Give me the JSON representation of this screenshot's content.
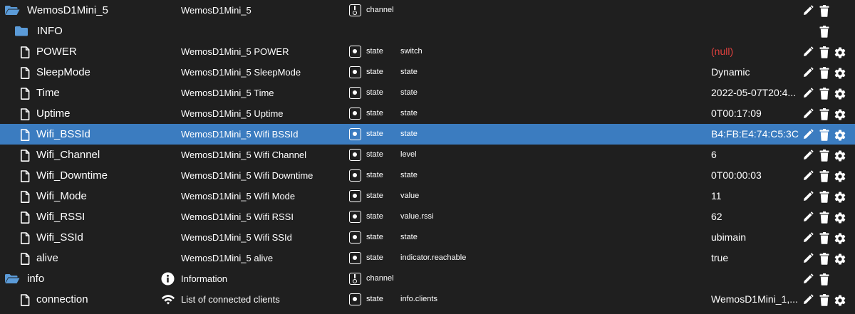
{
  "colors": {
    "background": "#1f1f1f",
    "selected_row": "#3b7cc0",
    "folder": "#5b9bd8",
    "null_value": "#e0413e",
    "text": "#ffffff"
  },
  "rows": [
    {
      "id": "WemosD1Mini_5",
      "level": 0,
      "tree_icon": "folder-open-icon",
      "name": "WemosD1Mini_5",
      "name_icon": "",
      "type_icon": "channel-icon",
      "type": "channel",
      "role": "",
      "value": "",
      "value_state": "",
      "actions": [
        "edit-icon",
        "delete-icon"
      ],
      "selected": false
    },
    {
      "id": "INFO",
      "level": 1,
      "tree_icon": "folder-icon",
      "name": "",
      "name_icon": "",
      "type_icon": "",
      "type": "",
      "role": "",
      "value": "",
      "value_state": "",
      "actions": [
        "delete-icon"
      ],
      "selected": false
    },
    {
      "id": "POWER",
      "level": 1,
      "tree_icon": "file-icon",
      "name": "WemosD1Mini_5 POWER",
      "name_icon": "",
      "type_icon": "state-icon",
      "type": "state",
      "role": "switch",
      "value": "(null)",
      "value_state": "null",
      "actions": [
        "edit-icon",
        "delete-icon",
        "settings-icon"
      ],
      "selected": false
    },
    {
      "id": "SleepMode",
      "level": 1,
      "tree_icon": "file-icon",
      "name": "WemosD1Mini_5 SleepMode",
      "name_icon": "",
      "type_icon": "state-icon",
      "type": "state",
      "role": "state",
      "value": "Dynamic",
      "value_state": "",
      "actions": [
        "edit-icon",
        "delete-icon",
        "settings-icon"
      ],
      "selected": false
    },
    {
      "id": "Time",
      "level": 1,
      "tree_icon": "file-icon",
      "name": "WemosD1Mini_5 Time",
      "name_icon": "",
      "type_icon": "state-icon",
      "type": "state",
      "role": "state",
      "value": "2022-05-07T20:4...",
      "value_state": "",
      "actions": [
        "edit-icon",
        "delete-icon",
        "settings-icon"
      ],
      "selected": false
    },
    {
      "id": "Uptime",
      "level": 1,
      "tree_icon": "file-icon",
      "name": "WemosD1Mini_5 Uptime",
      "name_icon": "",
      "type_icon": "state-icon",
      "type": "state",
      "role": "state",
      "value": "0T00:17:09",
      "value_state": "",
      "actions": [
        "edit-icon",
        "delete-icon",
        "settings-icon"
      ],
      "selected": false
    },
    {
      "id": "Wifi_BSSId",
      "level": 1,
      "tree_icon": "file-icon",
      "name": "WemosD1Mini_5 Wifi BSSId",
      "name_icon": "",
      "type_icon": "state-icon",
      "type": "state",
      "role": "state",
      "value": "B4:FB:E4:74:C5:3C",
      "value_state": "",
      "actions": [
        "edit-icon",
        "delete-icon",
        "settings-icon"
      ],
      "selected": true
    },
    {
      "id": "Wifi_Channel",
      "level": 1,
      "tree_icon": "file-icon",
      "name": "WemosD1Mini_5 Wifi Channel",
      "name_icon": "",
      "type_icon": "state-icon",
      "type": "state",
      "role": "level",
      "value": "6",
      "value_state": "",
      "actions": [
        "edit-icon",
        "delete-icon",
        "settings-icon"
      ],
      "selected": false
    },
    {
      "id": "Wifi_Downtime",
      "level": 1,
      "tree_icon": "file-icon",
      "name": "WemosD1Mini_5 Wifi Downtime",
      "name_icon": "",
      "type_icon": "state-icon",
      "type": "state",
      "role": "state",
      "value": "0T00:00:03",
      "value_state": "",
      "actions": [
        "edit-icon",
        "delete-icon",
        "settings-icon"
      ],
      "selected": false
    },
    {
      "id": "Wifi_Mode",
      "level": 1,
      "tree_icon": "file-icon",
      "name": "WemosD1Mini_5 Wifi Mode",
      "name_icon": "",
      "type_icon": "state-icon",
      "type": "state",
      "role": "value",
      "value": "11",
      "value_state": "",
      "actions": [
        "edit-icon",
        "delete-icon",
        "settings-icon"
      ],
      "selected": false
    },
    {
      "id": "Wifi_RSSI",
      "level": 1,
      "tree_icon": "file-icon",
      "name": "WemosD1Mini_5 Wifi RSSI",
      "name_icon": "",
      "type_icon": "state-icon",
      "type": "state",
      "role": "value.rssi",
      "value": "62",
      "value_state": "",
      "actions": [
        "edit-icon",
        "delete-icon",
        "settings-icon"
      ],
      "selected": false
    },
    {
      "id": "Wifi_SSId",
      "level": 1,
      "tree_icon": "file-icon",
      "name": "WemosD1Mini_5 Wifi SSId",
      "name_icon": "",
      "type_icon": "state-icon",
      "type": "state",
      "role": "state",
      "value": "ubimain",
      "value_state": "",
      "actions": [
        "edit-icon",
        "delete-icon",
        "settings-icon"
      ],
      "selected": false
    },
    {
      "id": "alive",
      "level": 1,
      "tree_icon": "file-icon",
      "name": "WemosD1Mini_5 alive",
      "name_icon": "",
      "type_icon": "state-icon",
      "type": "state",
      "role": "indicator.reachable",
      "value": "true",
      "value_state": "",
      "actions": [
        "edit-icon",
        "delete-icon",
        "settings-icon"
      ],
      "selected": false
    },
    {
      "id": "info",
      "level": 0,
      "tree_icon": "folder-open-icon",
      "name": "Information",
      "name_icon": "info-circle-icon",
      "type_icon": "channel-icon",
      "type": "channel",
      "role": "",
      "value": "",
      "value_state": "",
      "actions": [
        "edit-icon",
        "delete-icon"
      ],
      "selected": false
    },
    {
      "id": "connection",
      "level": 1,
      "tree_icon": "file-icon",
      "name": "List of connected clients",
      "name_icon": "wifi-icon",
      "type_icon": "state-icon",
      "type": "state",
      "role": "info.clients",
      "value": "WemosD1Mini_1,...",
      "value_state": "",
      "actions": [
        "edit-icon",
        "delete-icon",
        "settings-icon"
      ],
      "selected": false
    }
  ]
}
